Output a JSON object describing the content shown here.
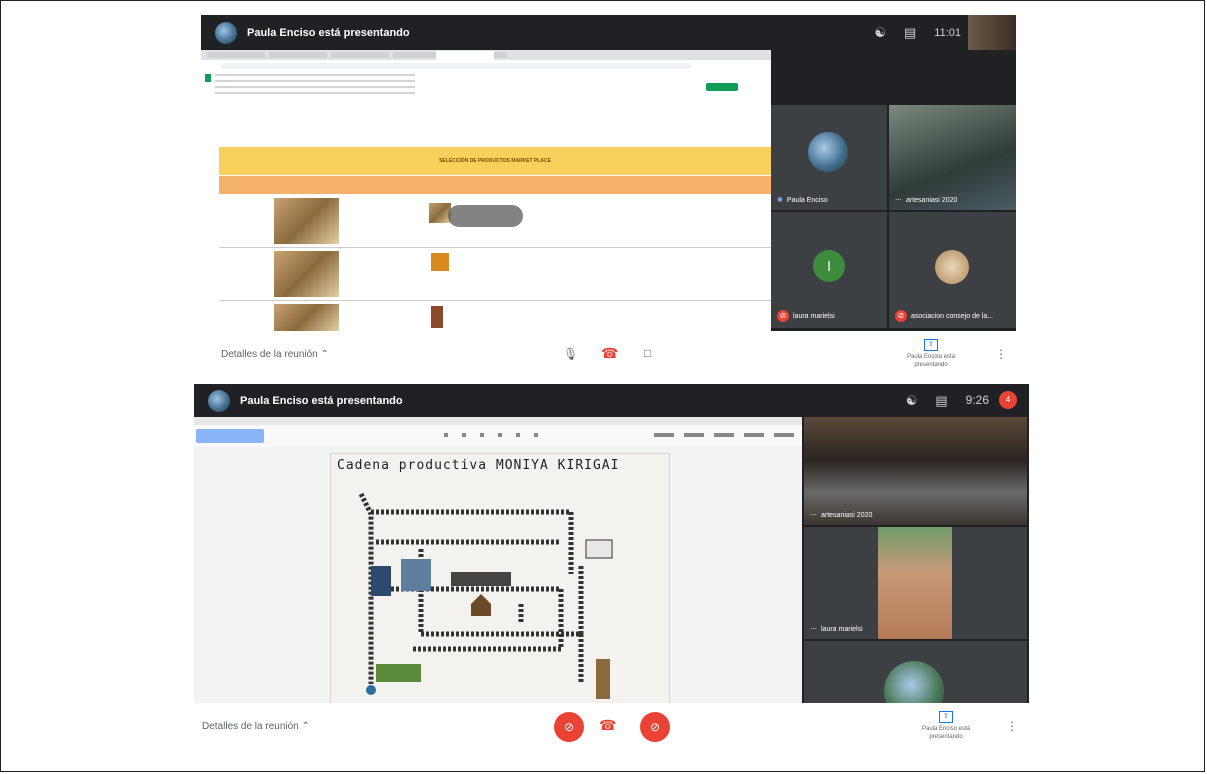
{
  "top": {
    "presenter_banner": "Paula Enciso está presentando",
    "clock": "11:01",
    "sheet_title": "SELECCIÓN DE PRODUCTOS MARKET PLACE",
    "tile_labels": [
      "Paula Enciso",
      "artesaniasi 2020",
      "laura marielsi",
      "asociacion consejo de la..."
    ],
    "tile_letter": "l",
    "meeting_details": "Detalles de la reunión",
    "presenting_label": "Paula Enciso está presentando"
  },
  "bottom": {
    "presenter_banner": "Paula Enciso está presentando",
    "clock": "9:26",
    "poster_title": "Cadena productiva MONIYA KIRIGAI",
    "tile_labels": [
      "artesaniasi 2020",
      "laura marielsi"
    ],
    "meeting_details": "Detalles de la reunión",
    "presenting_label": "Paula Enciso está presentando",
    "notification_count": "4"
  },
  "colors": {
    "meet_dark": "#202124",
    "tile_gray": "#3c4043",
    "end_call_red": "#ea4335",
    "sheet_header_yellow": "#f9d05c",
    "sheet_header_orange": "#f6b26b"
  }
}
